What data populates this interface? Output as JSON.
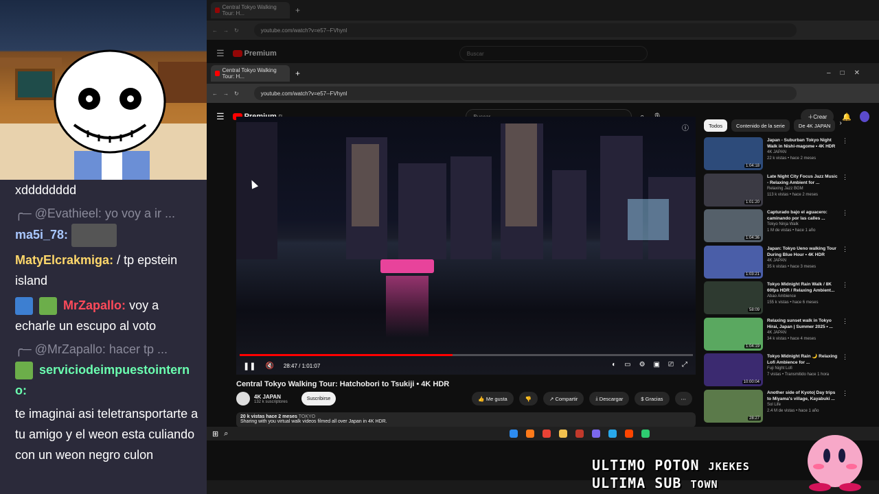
{
  "stream": {
    "chat": [
      {
        "user": "",
        "text": "xdddddddd"
      },
      {
        "user": "@Evathieel:",
        "text": "yo voy a ir ...",
        "reply": true
      },
      {
        "user": "ma5i_78:",
        "text": "",
        "user_color": "#a9c7ff"
      },
      {
        "user": "MatyElcrakmiga:",
        "text": "/ tp epstein island",
        "user_color": "#ffd86b"
      },
      {
        "user": "MrZapallo:",
        "text": "voy a echarle un escupo al voto",
        "user_color": "#ff4a5a"
      },
      {
        "user": "@MrZapallo:",
        "text": "hacer tp ...",
        "reply": true
      },
      {
        "user": "serviciodeimpuestointerno:",
        "text": "",
        "user_color": "#6bffb0"
      },
      {
        "user": "",
        "text": "te imaginai asi teletransportarte a tu amigo y el weon esta culiando con un weon negro culon"
      }
    ],
    "overlay_line1": "ULTIMO POTON",
    "overlay_line1_tail": "JKEKES",
    "overlay_line2": "ULTIMA SUB",
    "overlay_line2_tail": "TOWN"
  },
  "browser": {
    "tab_title": "Central Tokyo Walking Tour: H...",
    "url": "youtube.com/watch?v=e57--FVhynl",
    "search_placeholder": "Buscar",
    "create_label": "Crear",
    "premium_label": "Premium",
    "premium_sup": "CL"
  },
  "video": {
    "title": "Central Tokyo Walking Tour: Hatchobori to Tsukiji • 4K HDR",
    "time": "28:47 / 1:01:07",
    "progress": 0.47,
    "channel": "4K JAPAN",
    "subscribers": "132 k suscriptores",
    "subscribe_label": "Suscribirse",
    "actions": [
      "Me gusta",
      "Compartir",
      "Descargar",
      "Gracias"
    ],
    "views_date": "20 k vistas  hace 2 meses",
    "tag": "TOKYO",
    "description": "Sharing with you virtual walk videos filmed all over Japan in 4K HDR."
  },
  "chips": [
    "Todos",
    "Contenido de la serie",
    "De 4K JAPAN"
  ],
  "recommendations": [
    {
      "title": "Japan - Suburban Tokyo Night Walk in Nishi-magome • 4K HDR",
      "channel": "4K JAPAN",
      "meta": "22 k vistas • hace 2 meses",
      "duration": "1:04:18",
      "color": "#2d4b7a"
    },
    {
      "title": "Late Night City Focus Jazz Music - Relaxing Ambient for ...",
      "channel": "Relaxing Jazz BGM",
      "meta": "113 k vistas • hace 2 meses",
      "duration": "1:01:20",
      "color": "#3b3a44"
    },
    {
      "title": "Capturado bajo el aguacero: caminando por las calles ...",
      "channel": "Tokyo Ninja Walk",
      "meta": "1 M de vistas • hace 1 año",
      "duration": "1:04:36",
      "color": "#55606a"
    },
    {
      "title": "Japan: Tokyo Ueno walking Tour During Blue Hour • 4K HDR",
      "channel": "4K JAPAN",
      "meta": "35 k vistas • hace 3 meses",
      "duration": "1:03:21",
      "color": "#4a5ea8"
    },
    {
      "title": "Tokyo Midnight Rain Walk / 8K 60fps HDR / Relaxing Ambient...",
      "channel": "Abao Ambience",
      "meta": "155 k vistas • hace 6 meses",
      "duration": "58:09",
      "color": "#2e3a30"
    },
    {
      "title": "Relaxing sunset walk in Tokyo Hirai, Japan | Summer 2025 • ...",
      "channel": "4K JAPAN",
      "meta": "34 k vistas • hace 4 meses",
      "duration": "1:04:19",
      "color": "#5aa860"
    },
    {
      "title": "Tokyo Midnight Rain 🌙 Relaxing Lofi Ambience for ...",
      "channel": "Fuji Night Lofi",
      "meta": "7 vistas • Transmitido hace 1 hora",
      "duration": "10:00:04",
      "color": "#3b2a70"
    },
    {
      "title": "Another side of Kyoto| Day trips to Miyama's village, Kayabuki ...",
      "channel": "Sol Life",
      "meta": "2.4 M de vistas • hace 1 año",
      "duration": "28:27",
      "color": "#5b7a4a"
    }
  ]
}
